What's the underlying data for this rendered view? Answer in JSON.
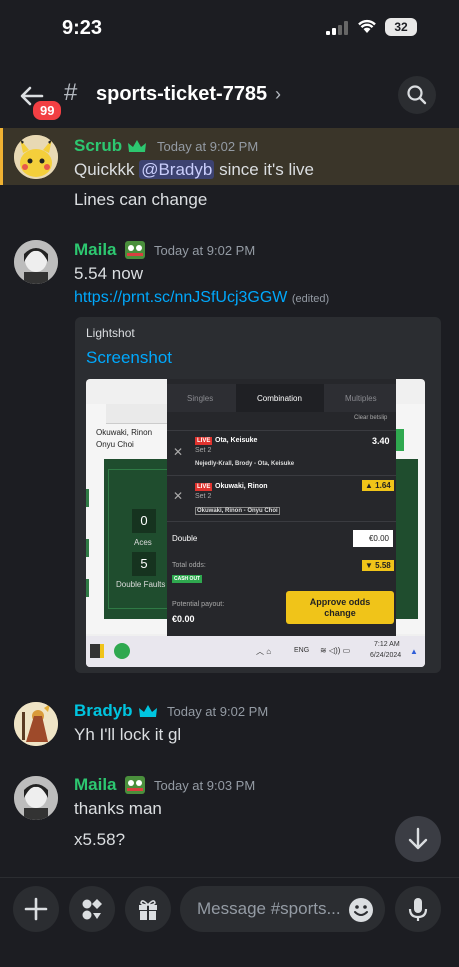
{
  "status": {
    "time": "9:23",
    "battery": "32"
  },
  "header": {
    "unread_count": "99",
    "channel": "sports-ticket-7785",
    "hash": "#"
  },
  "messages": [
    {
      "user": "Scrub",
      "time": "Today at 9:02 PM",
      "lines": [
        "Quickkk",
        "@Bradyb",
        "since it's live",
        "Lines can change"
      ]
    },
    {
      "user": "Maila",
      "time": "Today at 9:02 PM",
      "text": "5.54 now",
      "link": "https://prnt.sc/nnJSfUcj3GGW",
      "edited": "(edited)"
    },
    {
      "user": "Bradyb",
      "time": "Today at 9:02 PM",
      "text": "Yh I'll lock it gl"
    },
    {
      "user": "Maila",
      "time": "Today at 9:03 PM",
      "lines": [
        "thanks man",
        "x5.58?"
      ]
    }
  ],
  "embed": {
    "provider": "Lightshot",
    "title": "Screenshot"
  },
  "betslip": {
    "tabs": [
      "Singles",
      "Combination",
      "Multiples"
    ],
    "clear": "Clear betslip",
    "left": {
      "players": "Okuwaki, Rinon",
      "players2": "Onyu Choi",
      "aces_val": "0",
      "aces": "Aces",
      "df_val": "5",
      "df": "Double Faults"
    },
    "bets": [
      {
        "live": "LIVE",
        "name": "Ota, Keisuke",
        "set": "Set 2",
        "match": "Nejedly-Krall, Brody - Ota, Keisuke",
        "odds": "3.40"
      },
      {
        "live": "LIVE",
        "name": "Okuwaki, Rinon",
        "set": "Set 2",
        "match": "Okuwaki, Rinon - Onyu Choi",
        "odds": "▲ 1.64"
      }
    ],
    "double": "Double",
    "stake": "€0.00",
    "total_label": "Total odds:",
    "total": "▼ 5.58",
    "cashout": "CASH OUT",
    "payout_label": "Potential payout:",
    "payout": "€0.00",
    "approve": "Approve odds change",
    "taskbar": {
      "lang": "ENG",
      "clock": "7:12 AM",
      "date": "6/24/2024"
    }
  },
  "input": {
    "placeholder": "Message #sports..."
  },
  "colors": {
    "scrub": "#2dc770",
    "maila": "#2dc770",
    "bradyb": "#00c5e0",
    "link": "#00a8fc",
    "highlight": "#f0b232"
  }
}
